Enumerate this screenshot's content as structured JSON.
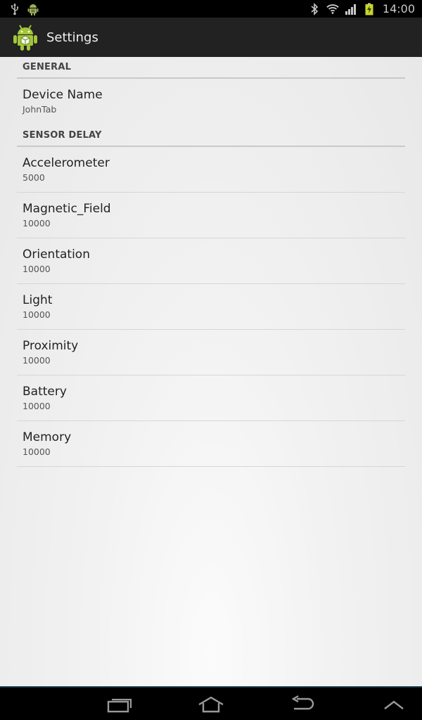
{
  "status_bar": {
    "time": "14:00",
    "left_icons": [
      "usb-icon",
      "android-notification-icon"
    ],
    "right_icons": [
      "bluetooth-icon",
      "wifi-icon",
      "signal-icon",
      "battery-charging-icon"
    ]
  },
  "action_bar": {
    "title": "Settings",
    "icon": "android-app-icon"
  },
  "sections": {
    "general": {
      "header": "GENERAL",
      "items": [
        {
          "title": "Device Name",
          "summary": "JohnTab"
        }
      ]
    },
    "sensor_delay": {
      "header": "SENSOR DELAY",
      "items": [
        {
          "title": "Accelerometer",
          "summary": "5000"
        },
        {
          "title": "Magnetic_Field",
          "summary": "10000"
        },
        {
          "title": "Orientation",
          "summary": "10000"
        },
        {
          "title": "Light",
          "summary": "10000"
        },
        {
          "title": "Proximity",
          "summary": "10000"
        },
        {
          "title": "Battery",
          "summary": "10000"
        },
        {
          "title": "Memory",
          "summary": "10000"
        }
      ]
    }
  },
  "nav_bar": {
    "buttons": [
      "recent-apps-icon",
      "home-icon",
      "back-icon",
      "menu-up-icon"
    ]
  },
  "colors": {
    "action_bar_bg": "#222222",
    "android_green": "#a4c639",
    "background": "#ececec",
    "divider": "#c9c9c9"
  }
}
